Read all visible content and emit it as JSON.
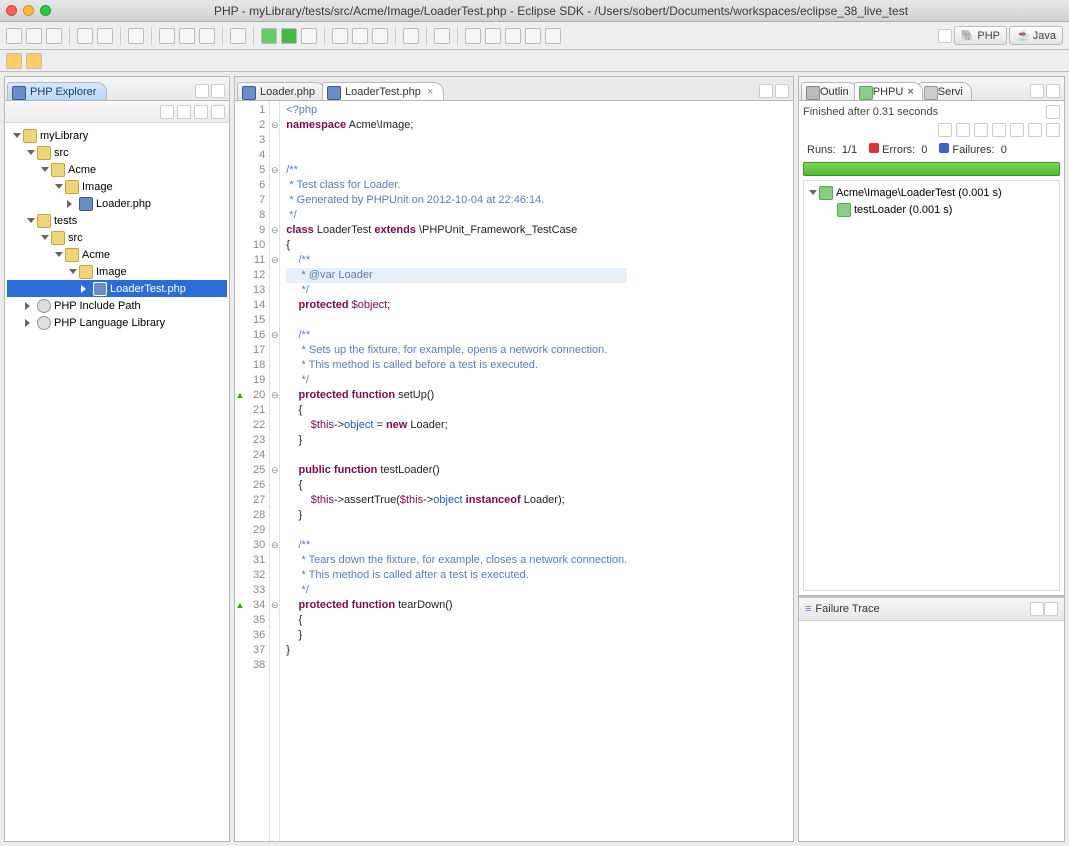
{
  "title": "PHP - myLibrary/tests/src/Acme/Image/LoaderTest.php - Eclipse SDK - /Users/sobert/Documents/workspaces/eclipse_38_live_test",
  "perspectives": {
    "php": "PHP",
    "java": "Java"
  },
  "explorer": {
    "title": "PHP Explorer",
    "items": {
      "root": "myLibrary",
      "src": "src",
      "acme": "Acme",
      "image": "Image",
      "loader": "Loader.php",
      "tests": "tests",
      "tsrc": "src",
      "tacme": "Acme",
      "timage": "Image",
      "loadertest": "LoaderTest.php",
      "include": "PHP Include Path",
      "lang": "PHP Language Library"
    }
  },
  "editor": {
    "tabs": [
      {
        "label": "Loader.php"
      },
      {
        "label": "LoaderTest.php"
      }
    ],
    "lines": [
      {
        "n": 1,
        "c": "<span class=\"com\">&lt;?php</span>"
      },
      {
        "n": 2,
        "c": "<span class=\"kw\">namespace</span> Acme\\Image;",
        "fold": "⊖"
      },
      {
        "n": 3,
        "c": ""
      },
      {
        "n": 4,
        "c": ""
      },
      {
        "n": 5,
        "c": "<span class=\"com\">/**</span>",
        "fold": "⊖"
      },
      {
        "n": 6,
        "c": "<span class=\"com\"> * Test class for Loader.</span>"
      },
      {
        "n": 7,
        "c": "<span class=\"com\"> * Generated by PHPUnit on 2012-10-04 at 22:46:14.</span>"
      },
      {
        "n": 8,
        "c": "<span class=\"com\"> */</span>"
      },
      {
        "n": 9,
        "c": "<span class=\"kw\">class</span> LoaderTest <span class=\"kw\">extends</span> \\PHPUnit_Framework_TestCase",
        "fold": "⊖"
      },
      {
        "n": 10,
        "c": "{"
      },
      {
        "n": 11,
        "c": "    <span class=\"com\">/**</span>",
        "fold": "⊖"
      },
      {
        "n": 12,
        "c": "    <span class=\"com\"> * @var Loader</span>",
        "hl": true
      },
      {
        "n": 13,
        "c": "    <span class=\"com\"> */</span>"
      },
      {
        "n": 14,
        "c": "    <span class=\"kw\">protected</span> <span class=\"var\">$object</span>;"
      },
      {
        "n": 15,
        "c": ""
      },
      {
        "n": 16,
        "c": "    <span class=\"com\">/**</span>",
        "fold": "⊖"
      },
      {
        "n": 17,
        "c": "    <span class=\"com\"> * Sets up the fixture, for example, opens a network connection.</span>"
      },
      {
        "n": 18,
        "c": "    <span class=\"com\"> * This method is called before a test is executed.</span>"
      },
      {
        "n": 19,
        "c": "    <span class=\"com\"> */</span>"
      },
      {
        "n": 20,
        "c": "    <span class=\"kw\">protected function</span> <span class=\"fn\">setUp</span>()",
        "fold": "⊖",
        "mk": "▲"
      },
      {
        "n": 21,
        "c": "    {"
      },
      {
        "n": 22,
        "c": "        <span class=\"var\">$this</span>-&gt;<span class=\"str\">object</span> = <span class=\"kw\">new</span> Loader;"
      },
      {
        "n": 23,
        "c": "    }"
      },
      {
        "n": 24,
        "c": ""
      },
      {
        "n": 25,
        "c": "    <span class=\"kw\">public function</span> <span class=\"fn\">testLoader</span>()",
        "fold": "⊖"
      },
      {
        "n": 26,
        "c": "    {"
      },
      {
        "n": 27,
        "c": "        <span class=\"var\">$this</span>-&gt;assertTrue(<span class=\"var\">$this</span>-&gt;<span class=\"str\">object</span> <span class=\"kw\">instanceof</span> Loader);"
      },
      {
        "n": 28,
        "c": "    }"
      },
      {
        "n": 29,
        "c": ""
      },
      {
        "n": 30,
        "c": "    <span class=\"com\">/**</span>",
        "fold": "⊖"
      },
      {
        "n": 31,
        "c": "    <span class=\"com\"> * Tears down the fixture, for example, closes a network connection.</span>"
      },
      {
        "n": 32,
        "c": "    <span class=\"com\"> * This method is called after a test is executed.</span>"
      },
      {
        "n": 33,
        "c": "    <span class=\"com\"> */</span>"
      },
      {
        "n": 34,
        "c": "    <span class=\"kw\">protected function</span> <span class=\"fn\">tearDown</span>()",
        "fold": "⊖",
        "mk": "▲"
      },
      {
        "n": 35,
        "c": "    {"
      },
      {
        "n": 36,
        "c": "    }"
      },
      {
        "n": 37,
        "c": "}"
      },
      {
        "n": 38,
        "c": ""
      }
    ]
  },
  "rightTabs": {
    "outline": "Outlin",
    "phpu": "PHPU",
    "servi": "Servi"
  },
  "results": {
    "finished": "Finished after 0.31 seconds",
    "runsLabel": "Runs:",
    "runs": "1/1",
    "errorsLabel": "Errors:",
    "errors": "0",
    "failuresLabel": "Failures:",
    "failures": "0",
    "tree": {
      "root": "Acme\\Image\\LoaderTest (0.001 s)",
      "child": "testLoader (0.001 s)"
    }
  },
  "failureTrace": "Failure Trace"
}
